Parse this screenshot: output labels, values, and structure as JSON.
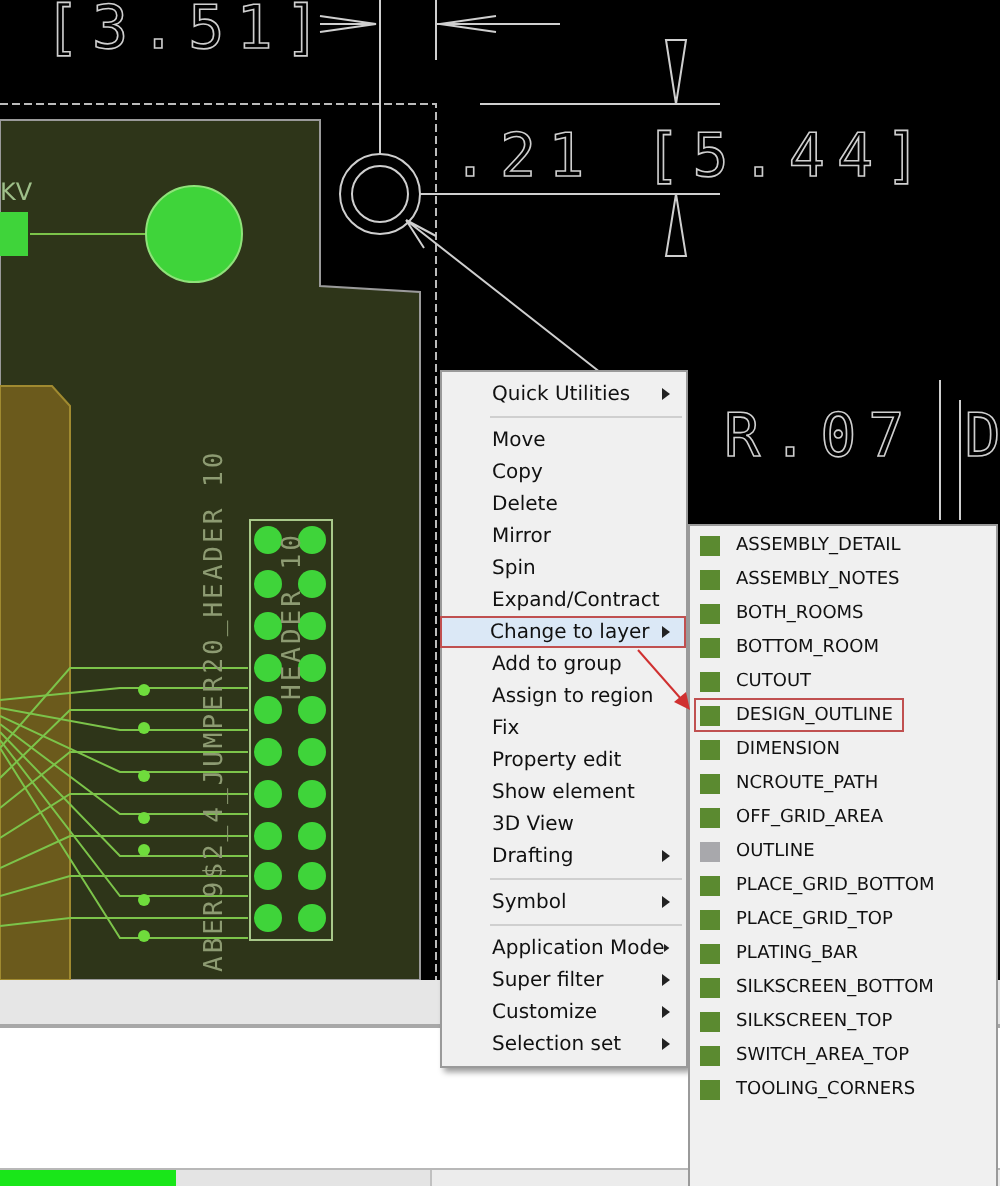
{
  "canvas": {
    "labels": [
      {
        "text": "[3.51]",
        "kind": "dimension"
      },
      {
        "text": ".21 [5.44]",
        "kind": "dimension"
      },
      {
        "text": "R.07 D",
        "kind": "dimension"
      },
      {
        "text": "KV",
        "kind": "refdes"
      },
      {
        "text": "ABER9$2_4_JUMPER20_HEADER 10",
        "kind": "vertical"
      },
      {
        "text": "HEADER 10",
        "kind": "vertical"
      }
    ]
  },
  "context_menu": {
    "items": [
      {
        "kind": "item",
        "label": "Quick Utilities",
        "submenu": true,
        "highlighted": false
      },
      {
        "kind": "separator"
      },
      {
        "kind": "item",
        "label": "Move",
        "submenu": false,
        "highlighted": false
      },
      {
        "kind": "item",
        "label": "Copy",
        "submenu": false,
        "highlighted": false
      },
      {
        "kind": "item",
        "label": "Delete",
        "submenu": false,
        "highlighted": false
      },
      {
        "kind": "item",
        "label": "Mirror",
        "submenu": false,
        "highlighted": false
      },
      {
        "kind": "item",
        "label": "Spin",
        "submenu": false,
        "highlighted": false
      },
      {
        "kind": "item",
        "label": "Expand/Contract",
        "submenu": false,
        "highlighted": false
      },
      {
        "kind": "item",
        "label": "Change to layer",
        "submenu": true,
        "highlighted": true
      },
      {
        "kind": "item",
        "label": "Add to group",
        "submenu": false,
        "highlighted": false
      },
      {
        "kind": "item",
        "label": "Assign to region",
        "submenu": false,
        "highlighted": false
      },
      {
        "kind": "item",
        "label": "Fix",
        "submenu": false,
        "highlighted": false
      },
      {
        "kind": "item",
        "label": "Property edit",
        "submenu": false,
        "highlighted": false
      },
      {
        "kind": "item",
        "label": "Show element",
        "submenu": false,
        "highlighted": false
      },
      {
        "kind": "item",
        "label": "3D View",
        "submenu": false,
        "highlighted": false
      },
      {
        "kind": "item",
        "label": "Drafting",
        "submenu": true,
        "highlighted": false
      },
      {
        "kind": "separator"
      },
      {
        "kind": "item",
        "label": "Symbol",
        "submenu": true,
        "highlighted": false
      },
      {
        "kind": "separator"
      },
      {
        "kind": "item",
        "label": "Application Mode",
        "submenu": true,
        "highlighted": false
      },
      {
        "kind": "item",
        "label": "Super filter",
        "submenu": true,
        "highlighted": false
      },
      {
        "kind": "item",
        "label": "Customize",
        "submenu": true,
        "highlighted": false
      },
      {
        "kind": "item",
        "label": "Selection set",
        "submenu": true,
        "highlighted": false
      }
    ]
  },
  "layer_submenu": {
    "items": [
      {
        "label": "ASSEMBLY_DETAIL",
        "color": "#5b8a30",
        "selected": false
      },
      {
        "label": "ASSEMBLY_NOTES",
        "color": "#5b8a30",
        "selected": false
      },
      {
        "label": "BOTH_ROOMS",
        "color": "#5b8a30",
        "selected": false
      },
      {
        "label": "BOTTOM_ROOM",
        "color": "#5b8a30",
        "selected": false
      },
      {
        "label": "CUTOUT",
        "color": "#5b8a30",
        "selected": false
      },
      {
        "label": "DESIGN_OUTLINE",
        "color": "#5b8a30",
        "selected": true
      },
      {
        "label": "DIMENSION",
        "color": "#5b8a30",
        "selected": false
      },
      {
        "label": "NCROUTE_PATH",
        "color": "#5b8a30",
        "selected": false
      },
      {
        "label": "OFF_GRID_AREA",
        "color": "#5b8a30",
        "selected": false
      },
      {
        "label": "OUTLINE",
        "color": "#a8a8ac",
        "selected": false
      },
      {
        "label": "PLACE_GRID_BOTTOM",
        "color": "#5b8a30",
        "selected": false
      },
      {
        "label": "PLACE_GRID_TOP",
        "color": "#5b8a30",
        "selected": false
      },
      {
        "label": "PLATING_BAR",
        "color": "#5b8a30",
        "selected": false
      },
      {
        "label": "SILKSCREEN_BOTTOM",
        "color": "#5b8a30",
        "selected": false
      },
      {
        "label": "SILKSCREEN_TOP",
        "color": "#5b8a30",
        "selected": false
      },
      {
        "label": "SWITCH_AREA_TOP",
        "color": "#5b8a30",
        "selected": false
      },
      {
        "label": "TOOLING_CORNERS",
        "color": "#5b8a30",
        "selected": false
      }
    ]
  },
  "status_bar": {
    "progress": {
      "level": 0.41
    }
  }
}
